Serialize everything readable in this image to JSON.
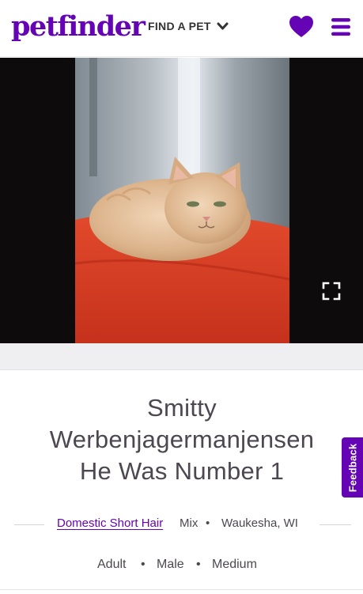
{
  "header": {
    "logo": "petfinder",
    "find_a_pet": "FIND A PET",
    "heart_icon": "heart-icon",
    "menu_icon": "hamburger-menu-icon",
    "brand_color": "#6504b5"
  },
  "photo": {
    "subject": "cat-photo",
    "expand_icon": "expand-icon"
  },
  "pet": {
    "name_line1": "Smitty",
    "name_line2": "Werbenjagermanjensen",
    "name_line3": "He Was Number 1",
    "breed": "Domestic Short Hair",
    "breed_suffix": "Mix",
    "separator": "•",
    "location": "Waukesha, WI",
    "age": "Adult",
    "sex": "Male",
    "size": "Medium"
  },
  "feedback": {
    "label": "Feedback"
  }
}
